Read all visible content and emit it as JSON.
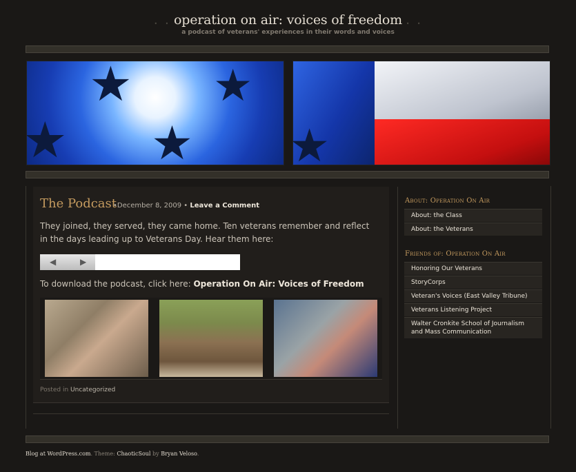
{
  "header": {
    "dots_left": ". .",
    "title": "operation on air: voices of freedom",
    "dots_right": ". .",
    "tagline": "a podcast of veterans' experiences in their words and voices"
  },
  "post": {
    "title": "The Podcast",
    "date": "December 8, 2009",
    "bullet": "•",
    "comment_link": "Leave a Comment",
    "body": "They joined, they served, they came home. Ten veterans remember and reflect in the days leading up to Veterans Day. Hear them here:",
    "download_text": "To download the podcast, click here:",
    "download_link": "Operation On Air: Voices of Freedom",
    "posted_in_label": "Posted in",
    "category": "Uncategorized"
  },
  "sidebar": {
    "about_heading": "About: Operation On Air",
    "about_items": [
      "About: the Class",
      "About: the Veterans"
    ],
    "friends_heading": "Friends of: Operation On Air",
    "friends_items": [
      "Honoring Our Veterans",
      "StoryCorps",
      "Veteran's Voices (East Valley Tribune)",
      "Veterans Listening Project",
      "Walter Cronkite School of Journalism and Mass Communication"
    ]
  },
  "footer": {
    "blog_link": "Blog at WordPress.com",
    "theme_label": ". Theme:",
    "theme_link": "ChaoticSoul",
    "by_label": "by",
    "author_link": "Bryan Veloso",
    "end": "."
  },
  "colors": {
    "background": "#1a1816",
    "accent_heading": "#c59b5f",
    "post_background": "#211e1b"
  }
}
